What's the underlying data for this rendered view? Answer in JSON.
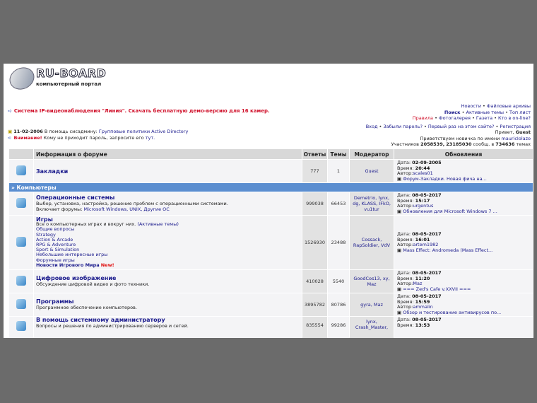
{
  "logo": {
    "title": "RU-BOARD",
    "subtitle": "компьютерный портал"
  },
  "promo": "Система IP-видеонаблюдения \"Линия\". Скачать бесплатную демо-версию для 16 камер.",
  "news": {
    "date": "11-02-2006",
    "prefix": "В помощь сисадмину:",
    "link": "Групповые политики Active Directory",
    "warn_label": "Внимание!",
    "warn_text": "Кому не приходит пароль, запросите его",
    "warn_link": "тут."
  },
  "toplinks": {
    "line1": [
      "Новости",
      "Файловые архивы"
    ],
    "line2": [
      "Поиск",
      "Активные темы",
      "Топ лист"
    ],
    "line3": [
      "Правила",
      "Фотогалерея",
      "Газета",
      "Кто в on-line?"
    ],
    "line4": [
      "Вход",
      "Забыли пароль?",
      "Первый раз на этом сайте?",
      "Регистрация"
    ],
    "greet": "Привет,",
    "user": "Guest",
    "newbie": "Приветствуем новичка по имени",
    "newbie_name": "mauricIolazo",
    "stats_prefix": "Участников",
    "members": "2058539,",
    "posts": "23185030",
    "posts_suffix": "сообщ. в",
    "topics": "734636",
    "topics_suffix": "темах"
  },
  "headers": {
    "info": "Информация о форуме",
    "replies": "Ответы",
    "topics": "Темы",
    "moderator": "Модератор",
    "updates": "Обновления"
  },
  "labels": {
    "date": "Дата:",
    "time": "Время:",
    "author": "Автор:"
  },
  "bookmarks": {
    "title": "Закладки",
    "replies": "777",
    "topics": "1",
    "moderator": "Guest",
    "date": "02-09-2005",
    "time": "20:44",
    "author": "scales01",
    "last": "Форум-Закладки. Новая фича на..."
  },
  "category": "» Компьютеры",
  "forums": [
    {
      "title": "Операционные системы",
      "desc": "Выбор, установка, настройка, решение проблем с операционными системами.",
      "includes_label": "Включает форумы:",
      "includes": "Microsoft Windows, UNIX, Другие ОС",
      "replies": "999038",
      "topics": "66453",
      "moderator": "Demetrio, lynx, dg, KLASS, IFkO, vu1tur",
      "date": "08-05-2017",
      "time": "15:17",
      "author": "urgentus",
      "last": "Обновления для Microsoft Windows 7 ..."
    },
    {
      "title": "Игры",
      "desc": "Все о компьютерных играх и вокруг них.",
      "active": "(Активные темы)",
      "subs": [
        "Общие вопросы",
        "Strategy",
        "Action & Arcade",
        "RPG & Adventure",
        "Sport & Simulation",
        "Небольшие интересные игры",
        "Форумные игры"
      ],
      "news": "Новости Игрового Мира",
      "new": "New!",
      "replies": "1526930",
      "topics": "23488",
      "moderator": "Cossack, RapSoldier, VdV",
      "date": "08-05-2017",
      "time": "16:01",
      "author": "artem1982",
      "last": "Mass Effect: Andromeda (Mass Effect..."
    },
    {
      "title": "Цифровое изображение",
      "desc": "Обсуждение цифровой видео и фото техники.",
      "replies": "410028",
      "topics": "5540",
      "moderator": "GoodCos13, xy, Maz",
      "date": "08-05-2017",
      "time": "11:20",
      "author": "Maz",
      "last": "=== Zed's Cafe v.XXVII ==="
    },
    {
      "title": "Программы",
      "desc": "Программное обеспечение компьютеров.",
      "replies": "3895782",
      "topics": "80786",
      "moderator": "gyra, Maz",
      "date": "08-05-2017",
      "time": "15:59",
      "author": "ammalin",
      "last": "Обзор и тестирование антивирусов по..."
    },
    {
      "title": "В помощь системному администратору",
      "desc": "Вопросы и решения по администрированию серверов и сетей.",
      "replies": "835554",
      "topics": "99286",
      "moderator": "lynx, Crash_Master,",
      "date": "08-05-2017",
      "time": "13:53"
    }
  ]
}
